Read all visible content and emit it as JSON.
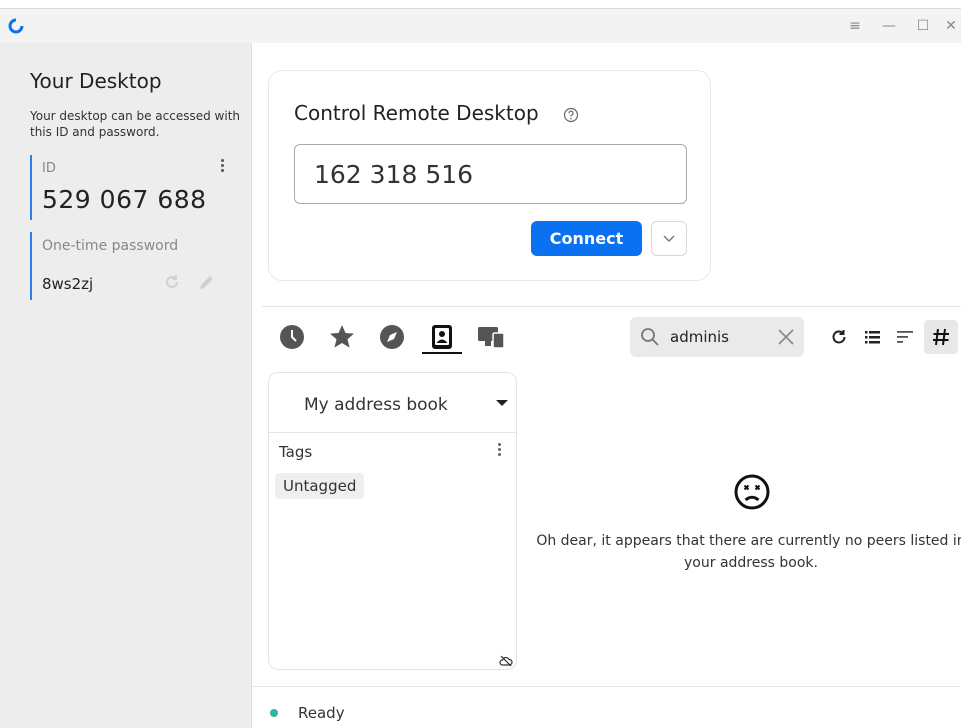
{
  "window": {
    "controls": {
      "menu": "≡",
      "minimize": "—",
      "maximize": "☐",
      "close": "✕"
    }
  },
  "left": {
    "title": "Your Desktop",
    "description": "Your desktop can be accessed with this ID and password.",
    "id_label": "ID",
    "id_value": "529 067 688",
    "password_label": "One-time password",
    "password_value": "8ws2zj"
  },
  "control": {
    "title": "Control Remote Desktop",
    "remote_id_value": "162 318 516",
    "connect_label": "Connect"
  },
  "tabs": [
    {
      "icon": "clock-icon",
      "name": "recent"
    },
    {
      "icon": "star-icon",
      "name": "favorites"
    },
    {
      "icon": "compass-icon",
      "name": "discovered"
    },
    {
      "icon": "address-book-icon",
      "name": "address-book",
      "active": true
    },
    {
      "icon": "devices-icon",
      "name": "group"
    }
  ],
  "search": {
    "value": "adminis"
  },
  "address_book": {
    "selected": "My address book",
    "tags_label": "Tags",
    "tags": [
      "Untagged"
    ]
  },
  "empty_state": {
    "message": "Oh dear, it appears that there are currently no peers listed in your address book."
  },
  "status": {
    "text": "Ready",
    "color": "#2fb5a0"
  },
  "colors": {
    "accent": "#0a72f0",
    "id_bar": "#2b7de9"
  }
}
